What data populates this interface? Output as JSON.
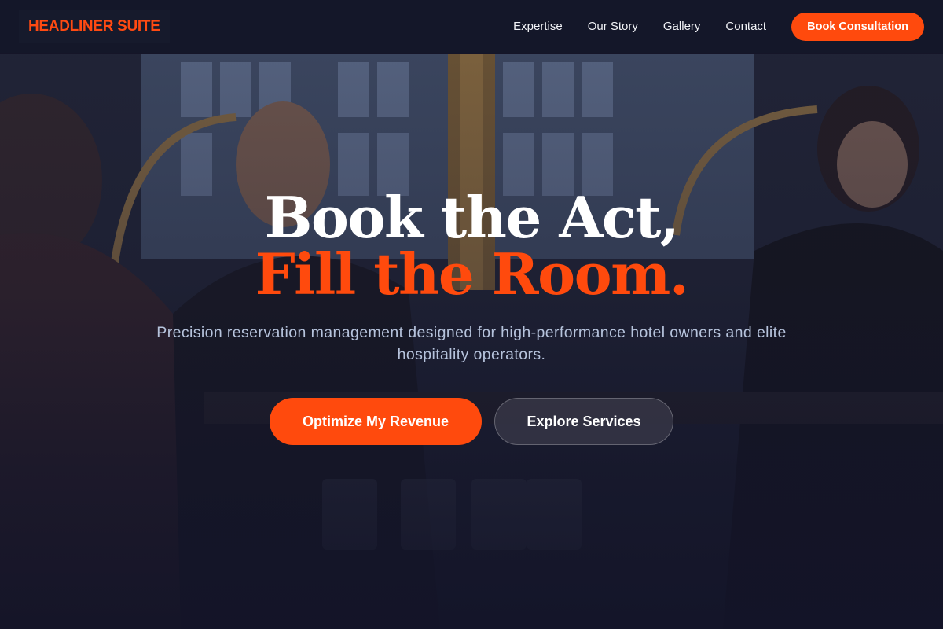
{
  "brand": {
    "name": "HEADLINER SUITE",
    "accent_color": "#ff4a0d",
    "background_color": "#151528"
  },
  "nav": {
    "links": [
      {
        "label": "Expertise"
      },
      {
        "label": "Our Story"
      },
      {
        "label": "Gallery"
      },
      {
        "label": "Contact"
      }
    ],
    "cta_label": "Book Consultation"
  },
  "hero": {
    "headline_line1": "Book the Act,",
    "headline_line2": "Fill the Room.",
    "subtitle": "Precision reservation management designed for high-performance hotel owners and elite hospitality operators.",
    "primary_cta": "Optimize My Revenue",
    "secondary_cta": "Explore Services",
    "background_image": "hotel-bar-bartenders-photo"
  }
}
